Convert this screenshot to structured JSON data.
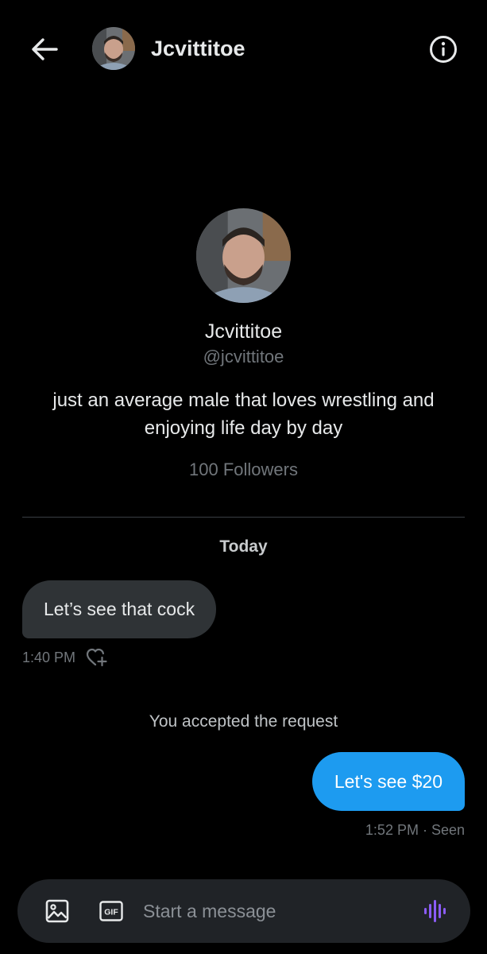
{
  "header": {
    "name": "Jcvittitoe",
    "back_icon": "arrow-left-icon",
    "info_icon": "info-circle-icon"
  },
  "profile": {
    "name": "Jcvittitoe",
    "handle": "@jcvittitoe",
    "bio": "just an average male  that loves wrestling and enjoying life day by day",
    "followers": "100 Followers"
  },
  "conversation": {
    "date_separator": "Today",
    "messages": [
      {
        "direction": "incoming",
        "text": "Let’s see that cock",
        "time": "1:40 PM",
        "reaction_icon": "heart-plus-icon"
      },
      {
        "direction": "system",
        "text": "You accepted the request"
      },
      {
        "direction": "outgoing",
        "text": "Let's see $20",
        "status": "1:52 PM · Seen"
      }
    ]
  },
  "composer": {
    "placeholder": "Start a message",
    "media_icon": "image-icon",
    "gif_label": "GIF",
    "voice_icon": "voice-wave-icon"
  },
  "colors": {
    "background": "#000000",
    "accent": "#1d9bf0",
    "incoming_bubble": "#2f3336",
    "composer_bg": "#202327",
    "voice_icon": "#8b5cf6",
    "secondary_text": "#71767b"
  }
}
